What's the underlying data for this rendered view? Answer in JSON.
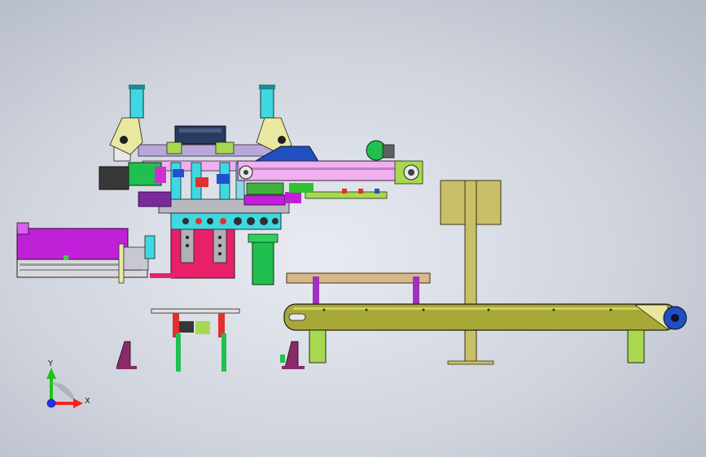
{
  "viewport": {
    "background": "#c9ced8"
  },
  "triad": {
    "x_label": "X",
    "y_label": "Y",
    "x_color": "#ff2020",
    "y_color": "#20c020",
    "z_color": "#2030ff"
  },
  "model_colors": {
    "machine_cyan": "#40d8e0",
    "machine_magenta": "#c020d8",
    "machine_pink": "#e8206a",
    "conveyor_olive": "#a8a838",
    "support_khaki": "#c8c068",
    "table_tan": "#d8b888",
    "rail_pink": "#f0b0f0",
    "motor_green": "#20c050",
    "leg_green": "#a8d850",
    "hopper_dark": "#2a3a60",
    "bracket_purple": "#8a2a6a",
    "grey_part": "#a0a0a8"
  }
}
